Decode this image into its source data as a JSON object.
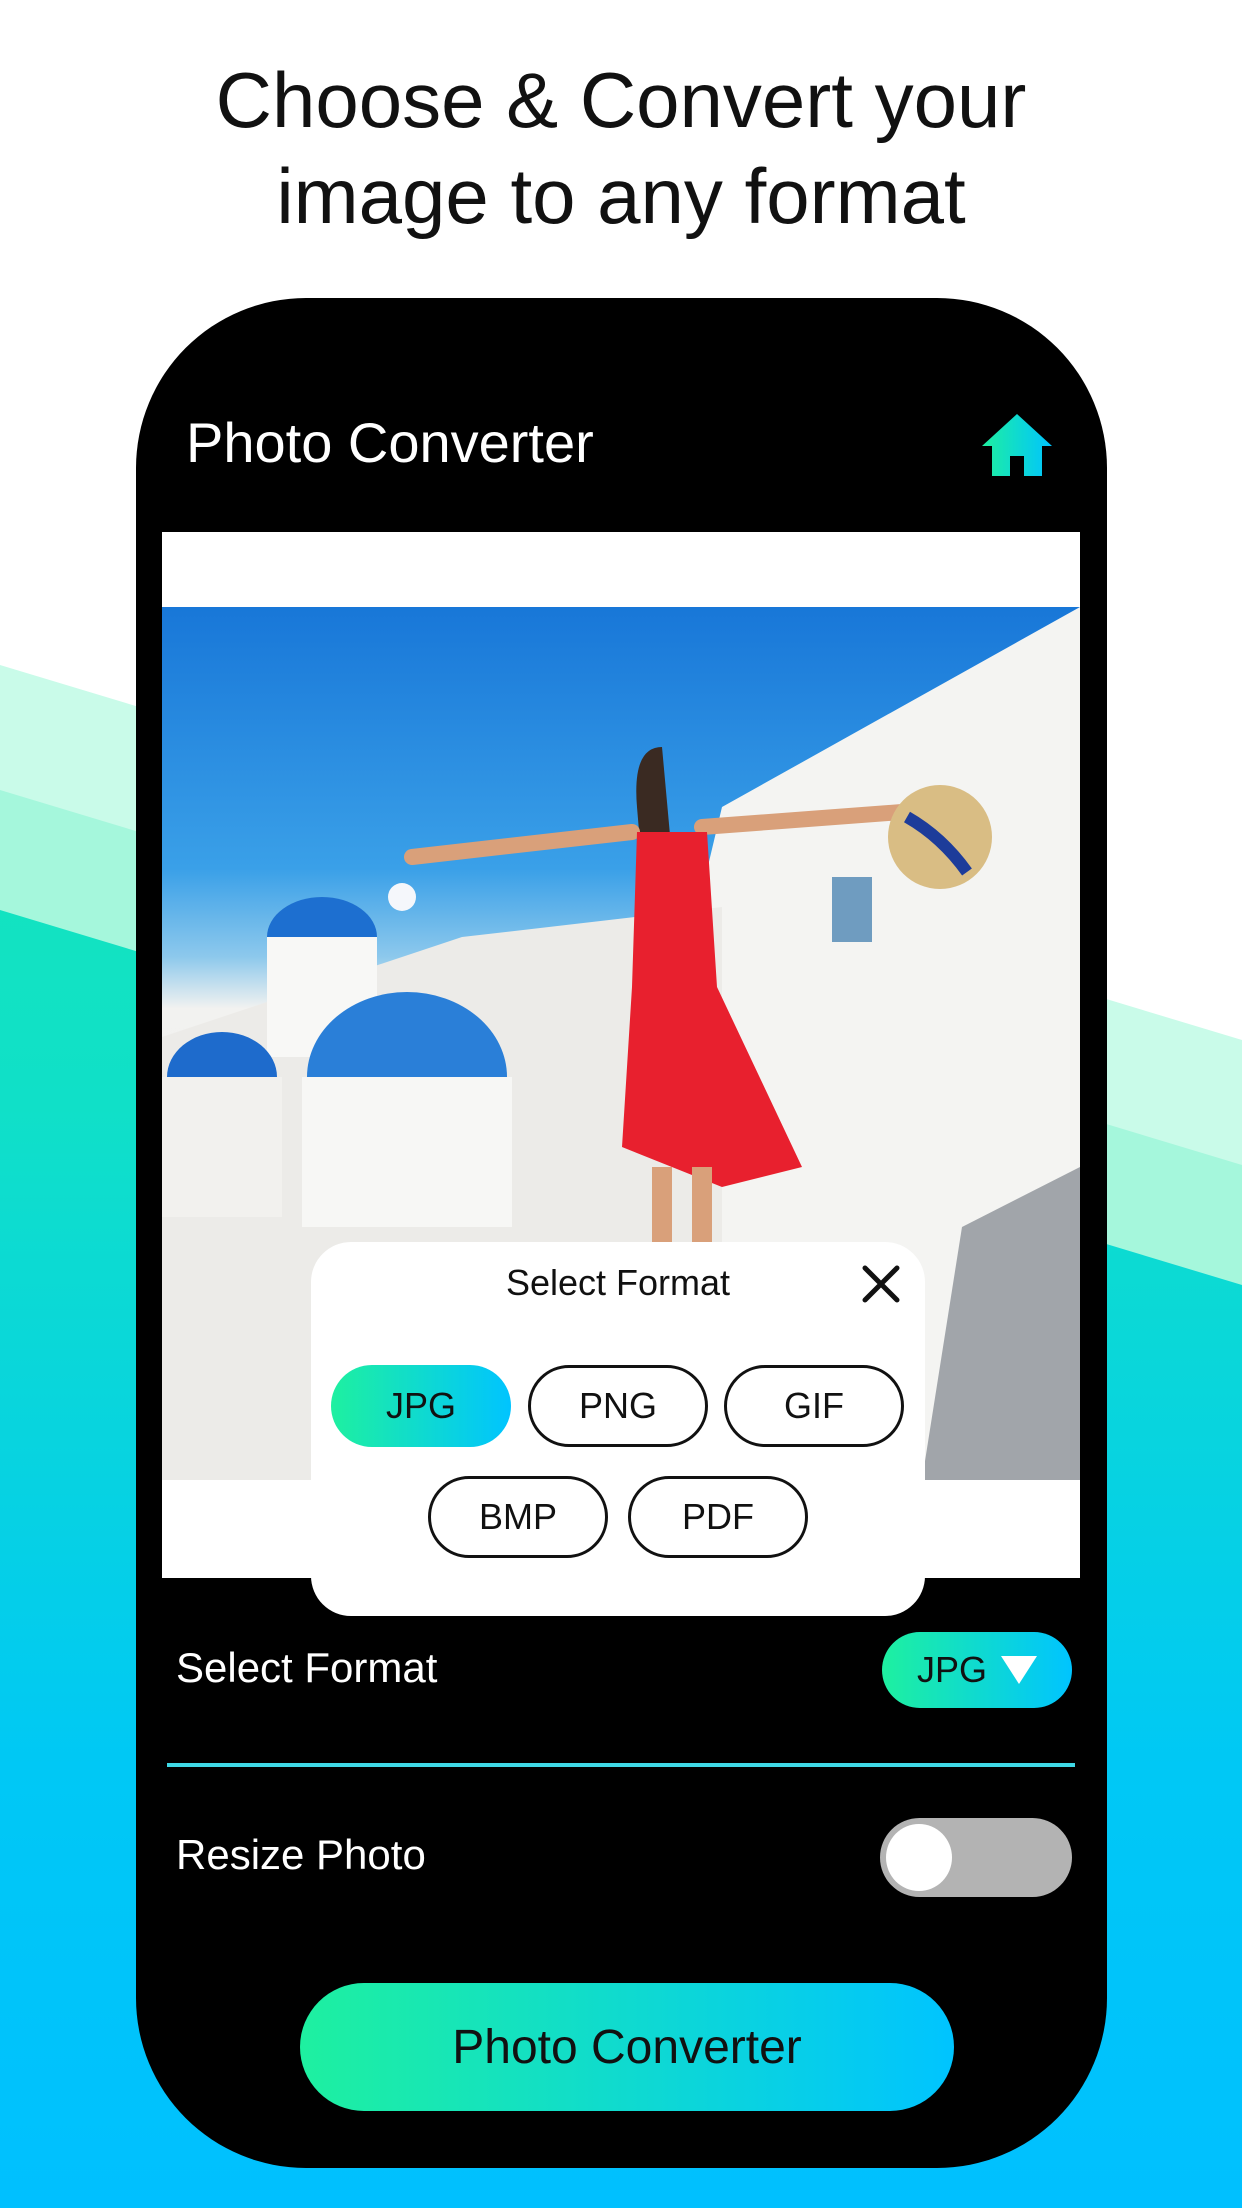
{
  "headline": {
    "line1": "Choose & Convert your",
    "line2": "image to any format"
  },
  "app": {
    "title": "Photo Converter",
    "home_icon": "home-icon"
  },
  "dialog": {
    "title": "Select Format",
    "close_icon": "close-icon",
    "formats": [
      "JPG",
      "PNG",
      "GIF",
      "BMP",
      "PDF"
    ],
    "selected": "JPG"
  },
  "settings": {
    "select_format_label": "Select Format",
    "selected_format": "JPG",
    "resize_label": "Resize Photo",
    "resize_enabled": false
  },
  "convert_button": "Photo Converter",
  "colors": {
    "accent_start": "#1ef0a0",
    "accent_end": "#00c4ff",
    "phone": "#000000",
    "divider": "#3fd9e6"
  }
}
